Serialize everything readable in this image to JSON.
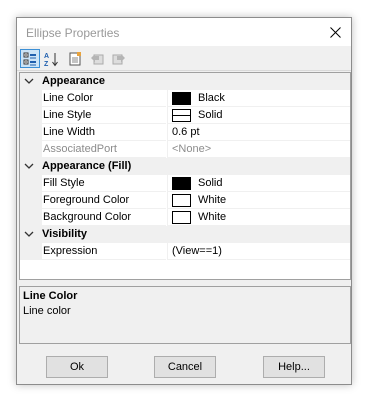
{
  "window": {
    "title": "Ellipse Properties"
  },
  "toolbar": {
    "buttons": [
      {
        "name": "categorized-icon"
      },
      {
        "name": "alphabetical-icon"
      },
      {
        "name": "property-pages-icon"
      },
      {
        "name": "back-icon"
      },
      {
        "name": "forward-icon"
      }
    ]
  },
  "grid": {
    "categories": [
      {
        "label": "Appearance",
        "props": [
          {
            "name": "Line Color",
            "value": "Black",
            "swatch": "#000000"
          },
          {
            "name": "Line Style",
            "value": "Solid",
            "swatch": "line"
          },
          {
            "name": "Line Width",
            "value": "0.6 pt"
          },
          {
            "name": "AssociatedPort",
            "value": "<None>",
            "disabled": true
          }
        ]
      },
      {
        "label": "Appearance (Fill)",
        "props": [
          {
            "name": "Fill Style",
            "value": "Solid",
            "swatch": "#000000"
          },
          {
            "name": "Foreground Color",
            "value": "White",
            "swatch": "#ffffff"
          },
          {
            "name": "Background Color",
            "value": "White",
            "swatch": "#ffffff"
          }
        ]
      },
      {
        "label": "Visibility",
        "props": [
          {
            "name": "Expression",
            "value": "(View==1)"
          }
        ]
      }
    ]
  },
  "description": {
    "title": "Line Color",
    "body": "Line color"
  },
  "footer": {
    "ok": "Ok",
    "cancel": "Cancel",
    "help": "Help..."
  },
  "colors": {
    "accent": "#3c8fd5",
    "window_bg": "#f0f0f0"
  }
}
